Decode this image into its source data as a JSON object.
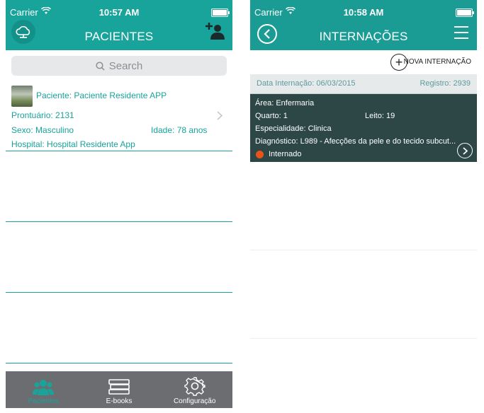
{
  "left": {
    "status": {
      "carrier": "Carrier",
      "time": "10:57 AM"
    },
    "title": "PACIENTES",
    "search_placeholder": "Search",
    "patient": {
      "name": "Paciente: Paciente Residente APP",
      "prontuario": "Prontuário: 2131",
      "sexo": "Sexo: Masculino",
      "idade": "Idade: 78 anos",
      "hospital": "Hospital: Hospital Residente App"
    },
    "tabs": [
      {
        "label": "Pacientes",
        "icon": "users-icon"
      },
      {
        "label": "E-books",
        "icon": "books-icon"
      },
      {
        "label": "Configuração",
        "icon": "gear-icon"
      }
    ],
    "colors": {
      "accent": "#18a39b",
      "tabbar": "#6c6d70"
    }
  },
  "right": {
    "status": {
      "carrier": "Carrier",
      "time": "10:58 AM"
    },
    "title": "INTERNAÇÕES",
    "nova_label": "NOVA INTERNAÇÃO",
    "card": {
      "data_internacao": "Data Internação: 06/03/2015",
      "registro": "Registro: 2939",
      "area": "Área: Enfermaria",
      "quarto": "Quarto: 1",
      "leito": "Leito: 19",
      "especialidade": "Especialidade: Clinica",
      "diagnostico": "Diagnóstico: L989 - Afecções da pele e do tecido subcut...",
      "status": "Internado",
      "status_color": "#e8531b"
    },
    "colors": {
      "card_bg": "#2d4747"
    }
  }
}
